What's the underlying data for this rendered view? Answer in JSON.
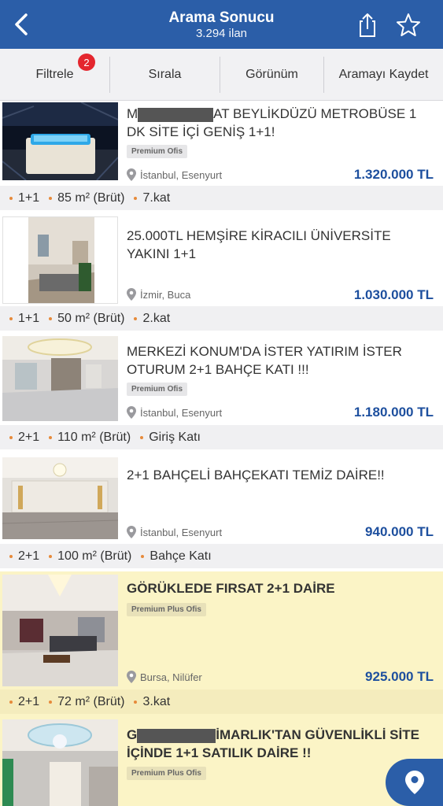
{
  "header": {
    "title": "Arama Sonucu",
    "subtitle": "3.294 ilan",
    "back_icon": "chevron-left-icon",
    "share_icon": "share-icon",
    "favorite_icon": "star-outline-icon",
    "color": "#2b5ea8"
  },
  "toolbar": {
    "filter_label": "Filtrele",
    "filter_badge": "2",
    "sort_label": "Sırala",
    "view_label": "Görünüm",
    "save_search_label": "Aramayı Kaydet"
  },
  "listings": [
    {
      "title_prefix": "M",
      "title_rest": "AT BEYLİKDÜZÜ METROBÜSE 1",
      "title_line2": "DK SİTE İÇİ GENİŞ 1+1!",
      "tag": "Premium Ofis",
      "location": "İstanbul, Esenyurt",
      "price": "1.320.000 TL",
      "attrs": [
        "1+1",
        "85 m² (Brüt)",
        "7.kat"
      ]
    },
    {
      "title": "25.000TL HEMŞİRE KİRACILI ÜNİVERSİTE YAKINI 1+1",
      "location": "İzmir, Buca",
      "price": "1.030.000 TL",
      "attrs": [
        "1+1",
        "50 m² (Brüt)",
        "2.kat"
      ]
    },
    {
      "title": "MERKEZİ KONUM'DA İSTER YATIRIM İSTER OTURUM 2+1 BAHÇE KATI !!!",
      "tag": "Premium Ofis",
      "location": "İstanbul, Esenyurt",
      "price": "1.180.000 TL",
      "attrs": [
        "2+1",
        "110 m² (Brüt)",
        "Giriş Katı"
      ]
    },
    {
      "title": "2+1 BAHÇELİ BAHÇEKATI TEMİZ DAİRE!!",
      "location": "İstanbul, Esenyurt",
      "price": "940.000 TL",
      "attrs": [
        "2+1",
        "100 m² (Brüt)",
        "Bahçe Katı"
      ]
    },
    {
      "title": "GÖRÜKLEDE FIRSAT 2+1 DAİRE",
      "tag": "Premium Plus Ofis",
      "location": "Bursa, Nilüfer",
      "price": "925.000 TL",
      "attrs": [
        "2+1",
        "72 m² (Brüt)",
        "3.kat"
      ]
    },
    {
      "title_prefix": "G",
      "title_rest": "İMARLIK'TAN GÜVENLİKLİ SİTE",
      "title_line2": "İÇİNDE 1+1 SATILIK DAİRE !!",
      "tag": "Premium Plus Ofis"
    }
  ],
  "map_button_icon": "map-pin-icon",
  "colors": {
    "price": "#1d4f9e",
    "plus_background": "#fbf4c6",
    "badge": "#e4262e",
    "bullet": "#e68a3a"
  }
}
